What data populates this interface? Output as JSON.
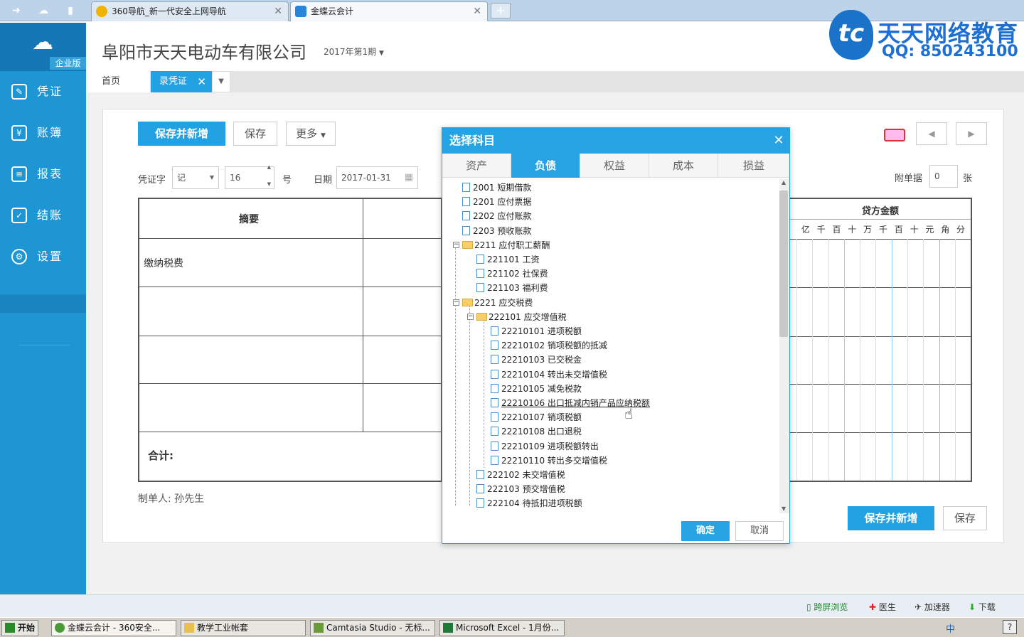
{
  "browser": {
    "tabs": [
      {
        "label": "360导航_新一代安全上网导航"
      },
      {
        "label": "金蝶云会计"
      }
    ],
    "new_tab": "+"
  },
  "brand": {
    "name": "天天网络教育",
    "qq": "QQ: 850243100"
  },
  "sidebar": {
    "edition": "企业版",
    "items": [
      {
        "label": "凭证"
      },
      {
        "label": "账簿"
      },
      {
        "label": "报表"
      },
      {
        "label": "结账"
      },
      {
        "label": "设置"
      }
    ]
  },
  "header": {
    "company": "阜阳市天天电动车有限公司",
    "period": "2017年第1期"
  },
  "tabs": {
    "home": "首页",
    "voucher": "录凭证",
    "close": "✕"
  },
  "toolbar": {
    "save_new": "保存并新增",
    "save": "保存",
    "more": "更多"
  },
  "form": {
    "voucher_word_label": "凭证字",
    "voucher_word_value": "记",
    "number_value": "16",
    "number_suffix": "号",
    "date_label": "日期",
    "date_value": "2017-01-31",
    "attach_label": "附单据",
    "attach_value": "0",
    "attach_suffix": "张"
  },
  "voucher_table": {
    "summary_header": "摘要",
    "credit_header": "贷方金额",
    "digit_headers": [
      "亿",
      "千",
      "百",
      "十",
      "万",
      "千",
      "百",
      "十",
      "元",
      "角",
      "分"
    ],
    "first_summary": "缴纳税费",
    "total_label": "合计:"
  },
  "footer": {
    "maker": "制单人: 孙先生",
    "save_new": "保存并新增",
    "save": "保存"
  },
  "dialog": {
    "title": "选择科目",
    "tabs": [
      "资产",
      "负债",
      "权益",
      "成本",
      "损益"
    ],
    "active_tab": "负债",
    "nodes": [
      {
        "code": "2001",
        "name": "短期借款"
      },
      {
        "code": "2201",
        "name": "应付票据"
      },
      {
        "code": "2202",
        "name": "应付账款"
      },
      {
        "code": "2203",
        "name": "预收账款"
      },
      {
        "code": "2211",
        "name": "应付职工薪酬"
      },
      {
        "code": "221101",
        "name": "工资"
      },
      {
        "code": "221102",
        "name": "社保费"
      },
      {
        "code": "221103",
        "name": "福利费"
      },
      {
        "code": "2221",
        "name": "应交税费"
      },
      {
        "code": "222101",
        "name": "应交增值税"
      },
      {
        "code": "22210101",
        "name": "进项税额"
      },
      {
        "code": "22210102",
        "name": "销项税额的抵减"
      },
      {
        "code": "22210103",
        "name": "已交税金"
      },
      {
        "code": "22210104",
        "name": "转出未交增值税"
      },
      {
        "code": "22210105",
        "name": "减免税款"
      },
      {
        "code": "22210106",
        "name": "出口抵减内销产品应纳税额"
      },
      {
        "code": "22210107",
        "name": "销项税额"
      },
      {
        "code": "22210108",
        "name": "出口退税"
      },
      {
        "code": "22210109",
        "name": "进项税额转出"
      },
      {
        "code": "22210110",
        "name": "转出多交增值税"
      },
      {
        "code": "222102",
        "name": "未交增值税"
      },
      {
        "code": "222103",
        "name": "预交增值税"
      },
      {
        "code": "222104",
        "name": "待抵扣进项税额"
      }
    ],
    "ok": "确定",
    "cancel": "取消"
  },
  "statusbar": {
    "items": [
      "跨屏浏览",
      "医生",
      "加速器",
      "下载"
    ]
  },
  "taskbar": {
    "start": "开始",
    "tasks": [
      {
        "label": "金蝶云会计 - 360安全..."
      },
      {
        "label": "教学工业帐套"
      },
      {
        "label": "Camtasia Studio - 无标..."
      },
      {
        "label": "Microsoft Excel - 1月份..."
      }
    ],
    "tray": [
      "中"
    ]
  },
  "colors": {
    "accent": "#22a2e2",
    "sidebar": "#1e96d4"
  }
}
